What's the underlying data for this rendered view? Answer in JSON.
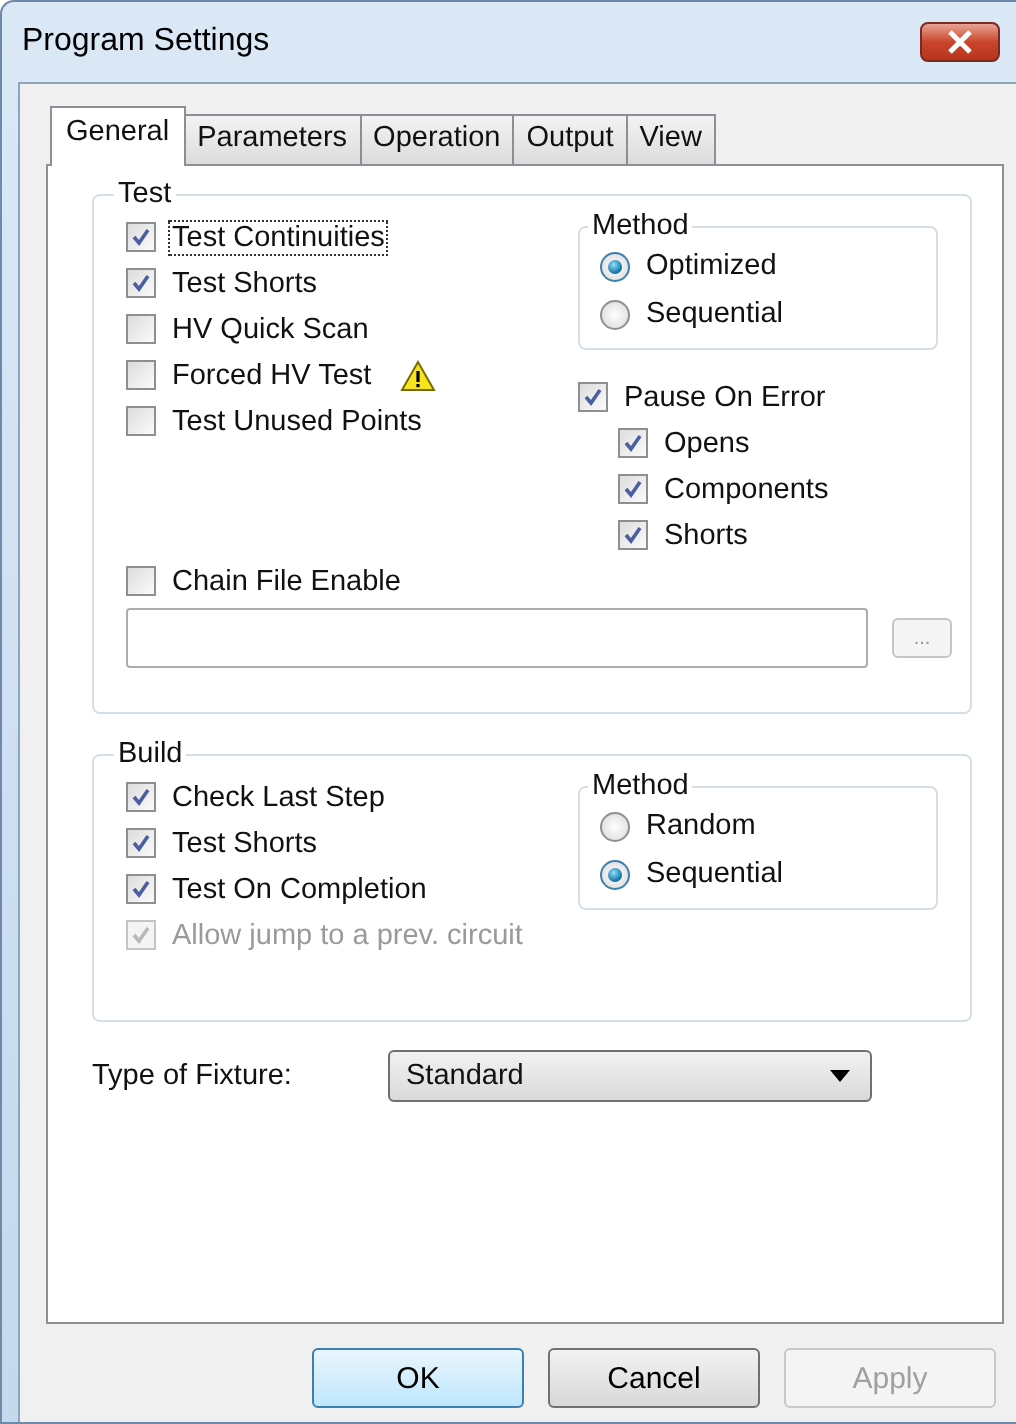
{
  "window": {
    "title": "Program Settings"
  },
  "tabs": [
    {
      "label": "General",
      "selected": true
    },
    {
      "label": "Parameters",
      "selected": false
    },
    {
      "label": "Operation",
      "selected": false
    },
    {
      "label": "Output",
      "selected": false
    },
    {
      "label": "View",
      "selected": false
    }
  ],
  "test_group": {
    "title": "Test",
    "options": [
      {
        "label": "Test Continuities",
        "checked": true,
        "focused": true,
        "warning": false
      },
      {
        "label": "Test Shorts",
        "checked": true,
        "focused": false,
        "warning": false
      },
      {
        "label": "HV Quick Scan",
        "checked": false,
        "focused": false,
        "warning": false
      },
      {
        "label": "Forced HV Test",
        "checked": false,
        "focused": false,
        "warning": true
      },
      {
        "label": "Test Unused Points",
        "checked": false,
        "focused": false,
        "warning": false
      }
    ],
    "method": {
      "title": "Method",
      "options": [
        {
          "label": "Optimized",
          "selected": true
        },
        {
          "label": "Sequential",
          "selected": false
        }
      ]
    },
    "pause_on_error": {
      "label": "Pause On Error",
      "checked": true,
      "options": [
        {
          "label": "Opens",
          "checked": true
        },
        {
          "label": "Components",
          "checked": true
        },
        {
          "label": "Shorts",
          "checked": true
        }
      ]
    },
    "chain_file": {
      "label": "Chain File Enable",
      "checked": false
    },
    "browse_button": "..."
  },
  "build_group": {
    "title": "Build",
    "options": [
      {
        "label": "Check Last Step",
        "checked": true,
        "disabled": false
      },
      {
        "label": "Test Shorts",
        "checked": true,
        "disabled": false
      },
      {
        "label": "Test On Completion",
        "checked": true,
        "disabled": false
      },
      {
        "label": "Allow jump to a prev. circuit",
        "checked": true,
        "disabled": true
      }
    ],
    "method": {
      "title": "Method",
      "options": [
        {
          "label": "Random",
          "selected": false
        },
        {
          "label": "Sequential",
          "selected": true
        }
      ]
    }
  },
  "fixture": {
    "label": "Type of Fixture:",
    "value": "Standard"
  },
  "buttons": [
    {
      "label": "OK",
      "default": true,
      "disabled": false
    },
    {
      "label": "Cancel",
      "default": false,
      "disabled": false
    },
    {
      "label": "Apply",
      "default": false,
      "disabled": true
    }
  ]
}
